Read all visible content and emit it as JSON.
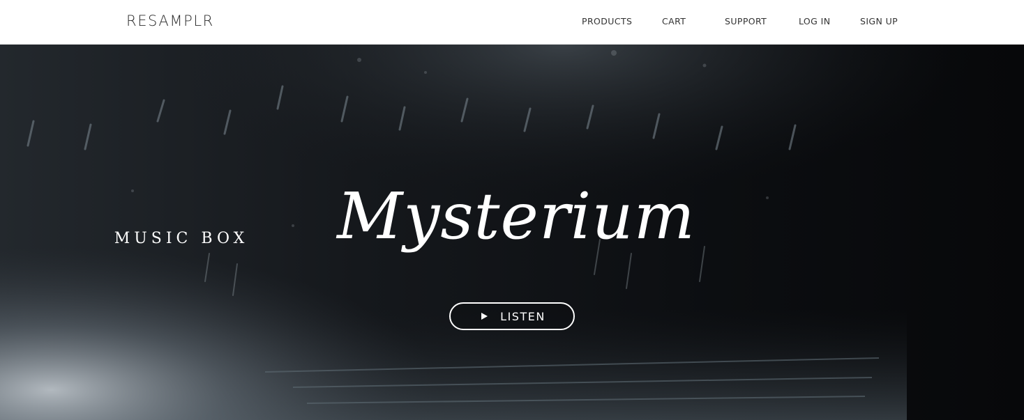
{
  "header": {
    "brand": "RESAMPLR",
    "nav": [
      {
        "id": "products",
        "label": "PRODUCTS"
      },
      {
        "id": "cart",
        "label": "CART"
      },
      {
        "id": "support",
        "label": "SUPPORT"
      },
      {
        "id": "login",
        "label": "LOG IN"
      },
      {
        "id": "signup",
        "label": "SIGN UP"
      }
    ]
  },
  "hero": {
    "title_script": "Mysterium",
    "subtitle": "MUSIC BOX",
    "listen_label": "LISTEN",
    "listen_icon": "play-icon"
  },
  "colors": {
    "nav_background": "#ffffff",
    "nav_text": "#333333",
    "hero_dark": "#0b0d10",
    "hero_text": "#ffffff"
  }
}
